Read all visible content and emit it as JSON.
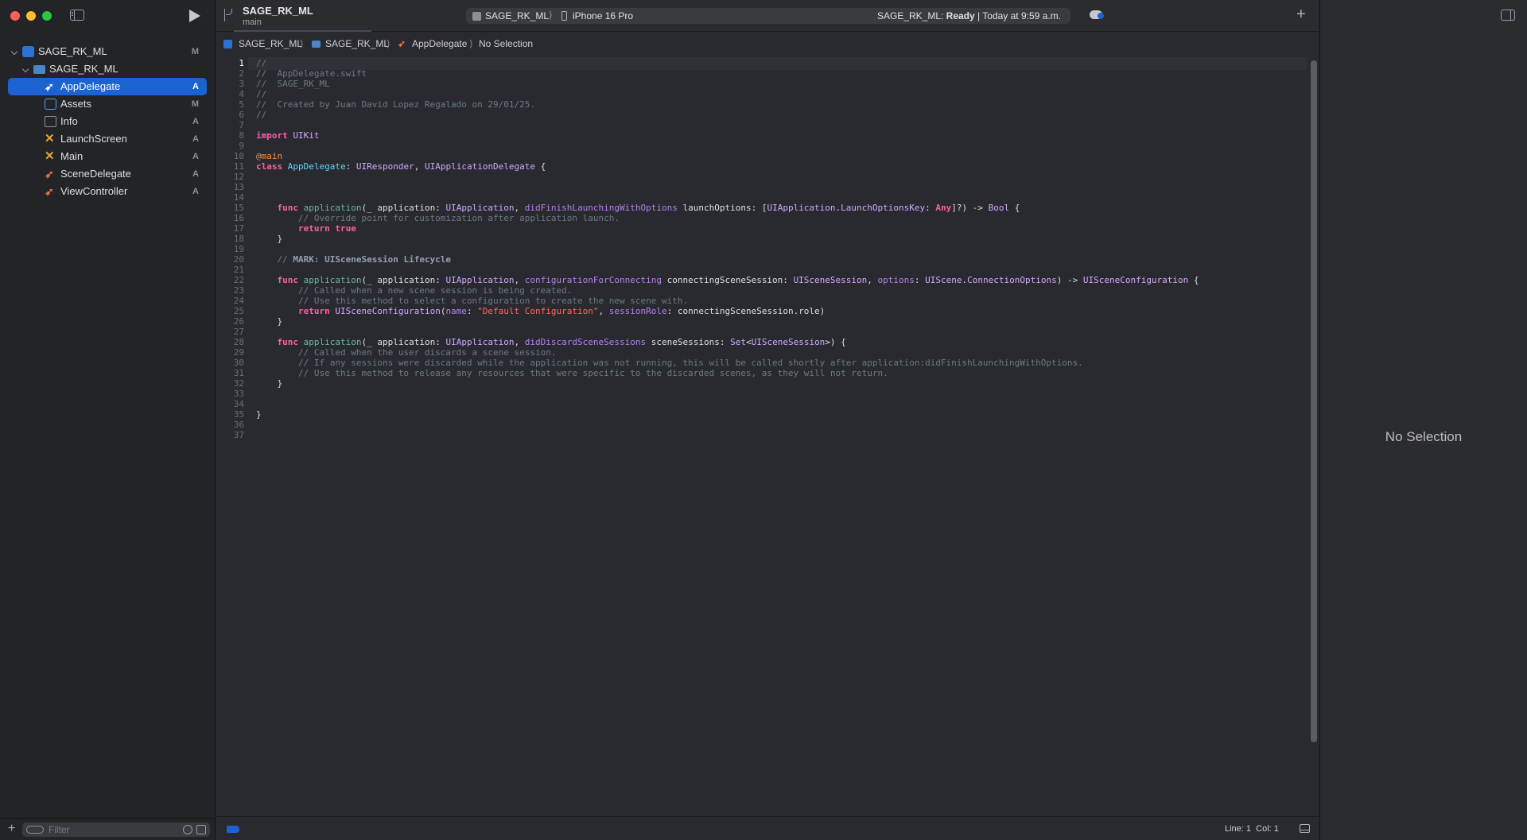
{
  "window": {
    "project_title": "SAGE_RK_ML",
    "branch": "main"
  },
  "toolbar": {
    "scheme": "SAGE_RK_ML",
    "scheme_separator": "⟩",
    "device": "iPhone 16 Pro",
    "status_prefix": "SAGE_RK_ML: ",
    "status_bold": "Ready",
    "status_suffix": " | Today at 9:59 a.m.",
    "add_label": "+"
  },
  "navigator": {
    "items": [
      {
        "label": "SAGE_RK_ML",
        "status": "M",
        "icon": "project-icon"
      },
      {
        "label": "SAGE_RK_ML",
        "status": "",
        "icon": "folder-icon"
      },
      {
        "label": "AppDelegate",
        "status": "A",
        "icon": "swift-file-icon"
      },
      {
        "label": "Assets",
        "status": "M",
        "icon": "asset-catalog-icon"
      },
      {
        "label": "Info",
        "status": "A",
        "icon": "plist-icon"
      },
      {
        "label": "LaunchScreen",
        "status": "A",
        "icon": "storyboard-icon"
      },
      {
        "label": "Main",
        "status": "A",
        "icon": "storyboard-icon"
      },
      {
        "label": "SceneDelegate",
        "status": "A",
        "icon": "swift-file-icon"
      },
      {
        "label": "ViewController",
        "status": "A",
        "icon": "swift-file-icon"
      }
    ],
    "filter_placeholder": "Filter",
    "add_label": "+"
  },
  "breadcrumb": {
    "items": [
      "SAGE_RK_ML",
      "SAGE_RK_ML",
      "AppDelegate",
      "No Selection"
    ],
    "separator": "⟩"
  },
  "code": {
    "lines": [
      "//",
      "//  AppDelegate.swift",
      "//  SAGE_RK_ML",
      "//",
      "//  Created by Juan David Lopez Regalado on 29/01/25.",
      "//",
      "",
      "import UIKit",
      "",
      "@main",
      "class AppDelegate: UIResponder, UIApplicationDelegate {",
      "",
      "",
      "",
      "    func application(_ application: UIApplication, didFinishLaunchingWithOptions launchOptions: [UIApplication.LaunchOptionsKey: Any]?) -> Bool {",
      "        // Override point for customization after application launch.",
      "        return true",
      "    }",
      "",
      "    // MARK: UISceneSession Lifecycle",
      "",
      "    func application(_ application: UIApplication, configurationForConnecting connectingSceneSession: UISceneSession, options: UIScene.ConnectionOptions) -> UISceneConfiguration {",
      "        // Called when a new scene session is being created.",
      "        // Use this method to select a configuration to create the new scene with.",
      "        return UISceneConfiguration(name: \"Default Configuration\", sessionRole: connectingSceneSession.role)",
      "    }",
      "",
      "    func application(_ application: UIApplication, didDiscardSceneSessions sceneSessions: Set<UISceneSession>) {",
      "        // Called when the user discards a scene session.",
      "        // If any sessions were discarded while the application was not running, this will be called shortly after application:didFinishLaunchingWithOptions.",
      "        // Use this method to release any resources that were specific to the discarded scenes, as they will not return.",
      "    }",
      "",
      "",
      "}",
      "",
      ""
    ]
  },
  "status_bar": {
    "line_col": "Line: 1  Col: 1"
  },
  "inspector": {
    "empty_text": "No Selection"
  },
  "colors": {
    "accent": "#1b63d0",
    "keyword": "#fc5fa3",
    "comment": "#6c7986",
    "type": "#d0a8ff",
    "class_decl": "#5dd8ff",
    "string": "#fc6a5d"
  }
}
